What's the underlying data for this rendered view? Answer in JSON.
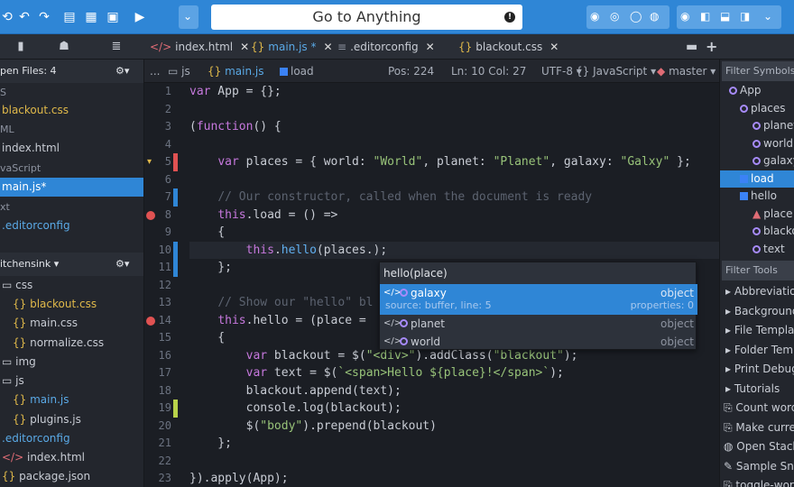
{
  "toolbar": {
    "goto": "Go to Anything"
  },
  "left_tabs": [
    "files",
    "people",
    "database"
  ],
  "tabs": [
    {
      "label": "index.html",
      "icon": "</>"
    },
    {
      "label": "main.js",
      "icon": "{}",
      "mod": "*"
    },
    {
      "label": ".editorconfig",
      "icon": "≡"
    },
    {
      "label": "blackout.css",
      "icon": "{}"
    }
  ],
  "open_files": {
    "title": "pen Files: 4",
    "items": [
      {
        "label": "S",
        "grp": true
      },
      {
        "label": "blackout.css"
      },
      {
        "label": "ML",
        "grp": true
      },
      {
        "label": "index.html"
      },
      {
        "label": "vaScript",
        "grp": true
      },
      {
        "label": "main.js*",
        "sel": true
      },
      {
        "label": "xt",
        "grp": true
      },
      {
        "label": ".editorconfig"
      }
    ]
  },
  "project": {
    "title": "itchensink",
    "items": [
      "css",
      "blackout.css",
      "main.css",
      "normalize.css",
      "img",
      "js",
      "main.js",
      "plugins.js",
      ".editorconfig",
      "index.html",
      "package.json"
    ]
  },
  "crumb": {
    "dots": "...",
    "js": "js",
    "file": "main.js",
    "sym": "load",
    "pos": "Pos: 224",
    "lncol": "Ln: 10 Col: 27",
    "enc": "UTF-8",
    "lang": "JavaScript",
    "branch": "master"
  },
  "lines": [
    "1",
    "2",
    "3",
    "4",
    "5",
    "6",
    "7",
    "8",
    "9",
    "10",
    "11",
    "12",
    "13",
    "14",
    "15",
    "16",
    "17",
    "18",
    "19",
    "20",
    "21",
    "22",
    "23"
  ],
  "autocomplete": {
    "sig": "hello(place)",
    "items": [
      {
        "name": "galaxy",
        "type": "object",
        "source": "source: buffer, line: 5",
        "props": "properties: 0"
      },
      {
        "name": "planet",
        "type": "object"
      },
      {
        "name": "world",
        "type": "object"
      }
    ]
  },
  "symbols": {
    "filter": "Filter Symbols",
    "items": [
      "App",
      "places",
      "planet",
      "world",
      "galaxy",
      "load",
      "hello",
      "place",
      "blackout",
      "text"
    ],
    "tools_filter": "Filter Tools",
    "tools": [
      "Abbreviations",
      "Background",
      "File Templates",
      "Folder Templates",
      "Print Debug",
      "Tutorials",
      "Count words",
      "Make current",
      "Open Stack",
      "Sample Snippet",
      "toggle-word"
    ]
  }
}
